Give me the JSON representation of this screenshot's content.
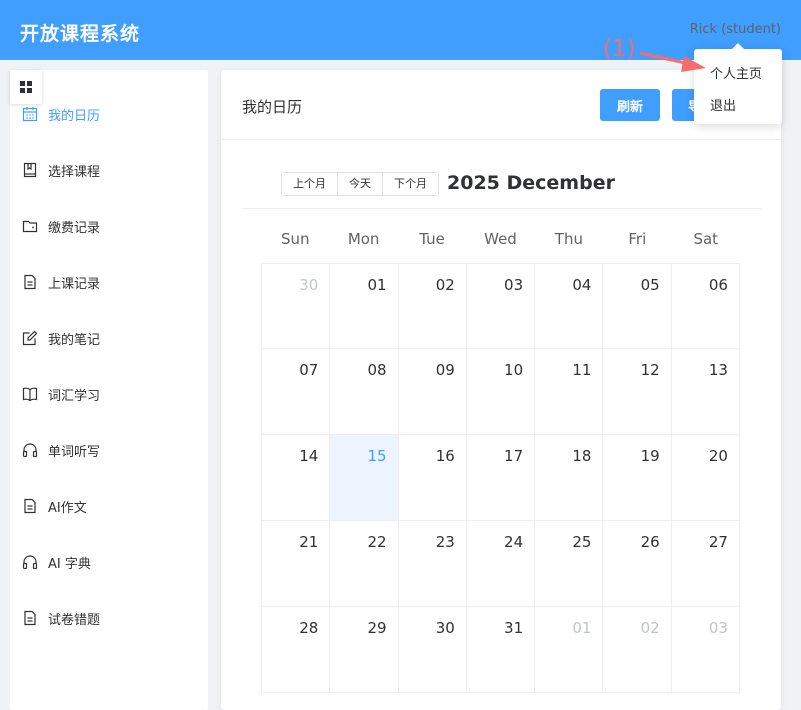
{
  "header": {
    "app_title": "开放课程系统",
    "user_name": "Rick (student)",
    "bg_color": "#409eff"
  },
  "sidebar": {
    "collapse_icon": "grid-icon",
    "items": [
      {
        "label": "我的日历",
        "icon": "calendar-icon",
        "active": true
      },
      {
        "label": "选择课程",
        "icon": "book-icon"
      },
      {
        "label": "缴费记录",
        "icon": "wallet-icon"
      },
      {
        "label": "上课记录",
        "icon": "document-icon"
      },
      {
        "label": "我的笔记",
        "icon": "edit-icon"
      },
      {
        "label": "词汇学习",
        "icon": "open-book-icon"
      },
      {
        "label": "单词听写",
        "icon": "headphones-icon"
      },
      {
        "label": "AI作文",
        "icon": "document-icon"
      },
      {
        "label": "AI 字典",
        "icon": "headphones-icon"
      },
      {
        "label": "试卷错题",
        "icon": "document-icon"
      }
    ]
  },
  "main": {
    "title": "我的日历",
    "refresh_label": "刷新",
    "other_button_label": "导"
  },
  "calendar": {
    "nav": {
      "prev": "上个月",
      "today": "今天",
      "next": "下个月"
    },
    "title": "2025 December",
    "weekdays": [
      "Sun",
      "Mon",
      "Tue",
      "Wed",
      "Thu",
      "Fri",
      "Sat"
    ],
    "weeks": [
      [
        {
          "d": "30",
          "other": true
        },
        {
          "d": "01"
        },
        {
          "d": "02"
        },
        {
          "d": "03"
        },
        {
          "d": "04"
        },
        {
          "d": "05"
        },
        {
          "d": "06"
        }
      ],
      [
        {
          "d": "07"
        },
        {
          "d": "08"
        },
        {
          "d": "09"
        },
        {
          "d": "10"
        },
        {
          "d": "11"
        },
        {
          "d": "12"
        },
        {
          "d": "13"
        }
      ],
      [
        {
          "d": "14"
        },
        {
          "d": "15",
          "today": true
        },
        {
          "d": "16"
        },
        {
          "d": "17"
        },
        {
          "d": "18"
        },
        {
          "d": "19"
        },
        {
          "d": "20"
        }
      ],
      [
        {
          "d": "21"
        },
        {
          "d": "22"
        },
        {
          "d": "23"
        },
        {
          "d": "24"
        },
        {
          "d": "25"
        },
        {
          "d": "26"
        },
        {
          "d": "27"
        }
      ],
      [
        {
          "d": "28"
        },
        {
          "d": "29"
        },
        {
          "d": "30"
        },
        {
          "d": "31"
        },
        {
          "d": "01",
          "other": true
        },
        {
          "d": "02",
          "other": true
        },
        {
          "d": "03",
          "other": true
        }
      ]
    ]
  },
  "user_dropdown": {
    "items": [
      "个人主页",
      "退出"
    ]
  },
  "annotation": {
    "label": "(1)",
    "color": "#f56c6c"
  }
}
